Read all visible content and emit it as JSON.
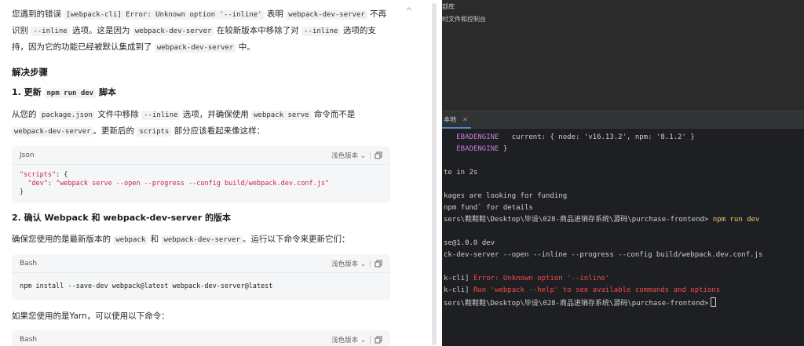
{
  "chat": {
    "intro": {
      "p1": "您遇到的错误 ",
      "code1": "[webpack-cli] Error: Unknown option '--inline'",
      "p2": " 表明 ",
      "code2": "webpack-dev-server",
      "p3": " 不再识别 ",
      "code3": "--inline",
      "p4": " 选项。这是因为 ",
      "code4": "webpack-dev-server",
      "p5": " 在较新版本中移除了对 ",
      "code5": "--inline",
      "p6": " 选项的支持，因为它的功能已经被默认集成到了 ",
      "code6": "webpack-dev-server",
      "p7": " 中。"
    },
    "solution_heading": "解决步骤",
    "step1": {
      "heading_prefix": "1. 更新 ",
      "heading_code": "npm run dev",
      "heading_suffix": " 脚本",
      "p1": "从您的 ",
      "code1": "package.json",
      "p2": " 文件中移除 ",
      "code2": "--inline",
      "p3": " 选项，并确保使用 ",
      "code3": "webpack serve",
      "p4": " 命令而不是 ",
      "code4": "webpack-dev-server",
      "p5": "。更新后的 ",
      "code5": "scripts",
      "p6": " 部分应该看起来像这样："
    },
    "code_json": {
      "lang": "Json",
      "theme_label": "浅色版本",
      "line1_key": "\"scripts\"",
      "line1_rest": ": {",
      "line2_key": "\"dev\"",
      "line2_colon": ": ",
      "line2_val": "\"webpack serve --open --progress --config build/webpack.dev.conf.js\"",
      "line3": "}"
    },
    "step2": {
      "heading": "2. 确认 Webpack 和 webpack-dev-server 的版本",
      "p1": "确保您使用的是最新版本的 ",
      "code1": "webpack",
      "p2": " 和 ",
      "code2": "webpack-dev-server",
      "p3": "。运行以下命令来更新它们："
    },
    "code_bash": {
      "lang": "Bash",
      "theme_label": "浅色版本",
      "line1": "npm install --save-dev webpack@latest webpack-dev-server@latest"
    },
    "yarn_text": "如果您使用的是Yarn，可以使用以下命令：",
    "code_bash2": {
      "lang": "Bash",
      "theme_label": "浅色版本"
    }
  },
  "ide": {
    "tree_items": [
      "部库",
      "时文件和控制台"
    ],
    "terminal_tab": "本地",
    "terminal_lines": [
      {
        "a": "",
        "b": "EBADENGINE",
        "c": "   current: { node: 'v16.13.2', npm: '8.1.2' }"
      },
      {
        "a": "",
        "b": "EBADENGINE",
        "c": " }"
      },
      {
        "a": "te in 2s"
      },
      {
        "a": "kages are looking for funding"
      },
      {
        "a": "npm fund` for details"
      },
      {
        "a": "sers\\鞋鞋鞋\\Desktop\\毕设\\028-商品进销存系统\\源码\\purchase-frontend> ",
        "cmd": "npm run dev"
      },
      {
        "a": "se@1.0.0 dev"
      },
      {
        "a": "ck-dev-server --open --inline --progress --config build/webpack.dev.conf.js"
      },
      {
        "a": "k-cli] ",
        "err": "Error: Unknown option '--inline'"
      },
      {
        "a": "k-cli] ",
        "err": "Run 'webpack --help' to see available commands and options"
      },
      {
        "a": "sers\\鞋鞋鞋\\Desktop\\毕设\\028-商品进销存系统\\源码\\purchase-frontend>"
      }
    ]
  }
}
